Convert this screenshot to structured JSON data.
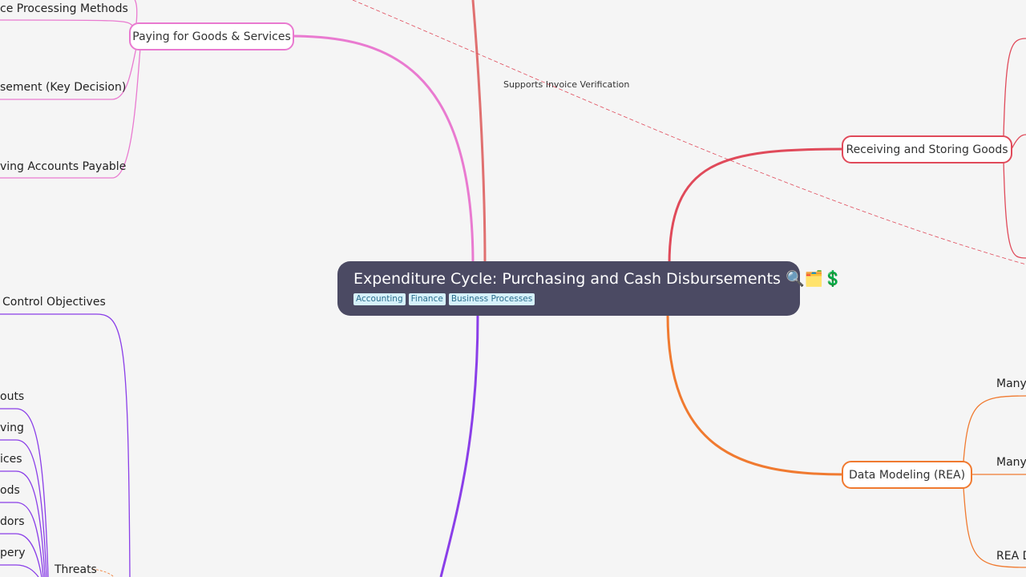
{
  "root": {
    "title": "Expenditure Cycle: Purchasing and Cash Disbursements",
    "emoji": "🔍🗂️💲",
    "tags": [
      "Accounting",
      "Finance",
      "Business Processes"
    ]
  },
  "nodes": {
    "paying": "Paying for Goods & Services",
    "receiving": "Receiving and Storing Goods",
    "data_modeling": "Data Modeling (REA)"
  },
  "left_labels": {
    "invoice_methods": "ce Processing Methods",
    "disbursement": "sement (Key Decision)",
    "accounts_payable": "ving Accounts Payable",
    "control_objectives": "Control Objectives",
    "threats": "Threats",
    "t1": "outs",
    "t2": "ving",
    "t3": "ices",
    "t4": "ods",
    "t5": "dors",
    "t6": "pery"
  },
  "right_labels": {
    "many1": "Many-",
    "many2": "Many-",
    "rea": "REA D"
  },
  "link_label": "Supports Invoice Verification",
  "colors": {
    "background": "#f5f5f5",
    "root": "#4b4a63",
    "pink": "#e97ad0",
    "red": "#e04a5a",
    "salmon": "#e07070",
    "orange": "#f07a30",
    "purple": "#8a3ee8"
  }
}
